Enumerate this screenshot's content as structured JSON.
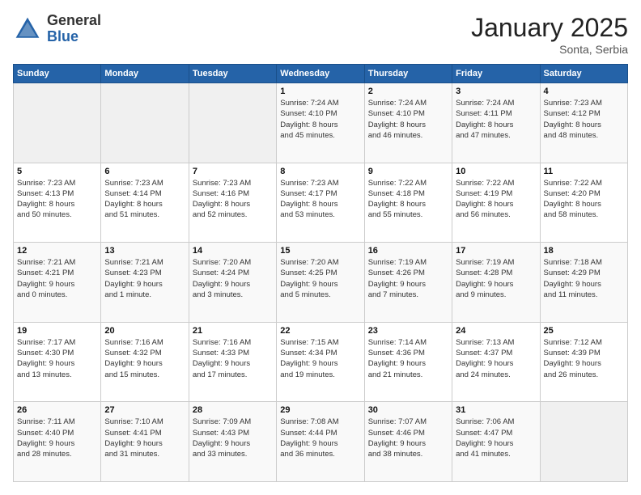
{
  "header": {
    "logo_general": "General",
    "logo_blue": "Blue",
    "month_title": "January 2025",
    "subtitle": "Sonta, Serbia"
  },
  "days_of_week": [
    "Sunday",
    "Monday",
    "Tuesday",
    "Wednesday",
    "Thursday",
    "Friday",
    "Saturday"
  ],
  "weeks": [
    [
      {
        "day": "",
        "info": ""
      },
      {
        "day": "",
        "info": ""
      },
      {
        "day": "",
        "info": ""
      },
      {
        "day": "1",
        "info": "Sunrise: 7:24 AM\nSunset: 4:10 PM\nDaylight: 8 hours\nand 45 minutes."
      },
      {
        "day": "2",
        "info": "Sunrise: 7:24 AM\nSunset: 4:10 PM\nDaylight: 8 hours\nand 46 minutes."
      },
      {
        "day": "3",
        "info": "Sunrise: 7:24 AM\nSunset: 4:11 PM\nDaylight: 8 hours\nand 47 minutes."
      },
      {
        "day": "4",
        "info": "Sunrise: 7:23 AM\nSunset: 4:12 PM\nDaylight: 8 hours\nand 48 minutes."
      }
    ],
    [
      {
        "day": "5",
        "info": "Sunrise: 7:23 AM\nSunset: 4:13 PM\nDaylight: 8 hours\nand 50 minutes."
      },
      {
        "day": "6",
        "info": "Sunrise: 7:23 AM\nSunset: 4:14 PM\nDaylight: 8 hours\nand 51 minutes."
      },
      {
        "day": "7",
        "info": "Sunrise: 7:23 AM\nSunset: 4:16 PM\nDaylight: 8 hours\nand 52 minutes."
      },
      {
        "day": "8",
        "info": "Sunrise: 7:23 AM\nSunset: 4:17 PM\nDaylight: 8 hours\nand 53 minutes."
      },
      {
        "day": "9",
        "info": "Sunrise: 7:22 AM\nSunset: 4:18 PM\nDaylight: 8 hours\nand 55 minutes."
      },
      {
        "day": "10",
        "info": "Sunrise: 7:22 AM\nSunset: 4:19 PM\nDaylight: 8 hours\nand 56 minutes."
      },
      {
        "day": "11",
        "info": "Sunrise: 7:22 AM\nSunset: 4:20 PM\nDaylight: 8 hours\nand 58 minutes."
      }
    ],
    [
      {
        "day": "12",
        "info": "Sunrise: 7:21 AM\nSunset: 4:21 PM\nDaylight: 9 hours\nand 0 minutes."
      },
      {
        "day": "13",
        "info": "Sunrise: 7:21 AM\nSunset: 4:23 PM\nDaylight: 9 hours\nand 1 minute."
      },
      {
        "day": "14",
        "info": "Sunrise: 7:20 AM\nSunset: 4:24 PM\nDaylight: 9 hours\nand 3 minutes."
      },
      {
        "day": "15",
        "info": "Sunrise: 7:20 AM\nSunset: 4:25 PM\nDaylight: 9 hours\nand 5 minutes."
      },
      {
        "day": "16",
        "info": "Sunrise: 7:19 AM\nSunset: 4:26 PM\nDaylight: 9 hours\nand 7 minutes."
      },
      {
        "day": "17",
        "info": "Sunrise: 7:19 AM\nSunset: 4:28 PM\nDaylight: 9 hours\nand 9 minutes."
      },
      {
        "day": "18",
        "info": "Sunrise: 7:18 AM\nSunset: 4:29 PM\nDaylight: 9 hours\nand 11 minutes."
      }
    ],
    [
      {
        "day": "19",
        "info": "Sunrise: 7:17 AM\nSunset: 4:30 PM\nDaylight: 9 hours\nand 13 minutes."
      },
      {
        "day": "20",
        "info": "Sunrise: 7:16 AM\nSunset: 4:32 PM\nDaylight: 9 hours\nand 15 minutes."
      },
      {
        "day": "21",
        "info": "Sunrise: 7:16 AM\nSunset: 4:33 PM\nDaylight: 9 hours\nand 17 minutes."
      },
      {
        "day": "22",
        "info": "Sunrise: 7:15 AM\nSunset: 4:34 PM\nDaylight: 9 hours\nand 19 minutes."
      },
      {
        "day": "23",
        "info": "Sunrise: 7:14 AM\nSunset: 4:36 PM\nDaylight: 9 hours\nand 21 minutes."
      },
      {
        "day": "24",
        "info": "Sunrise: 7:13 AM\nSunset: 4:37 PM\nDaylight: 9 hours\nand 24 minutes."
      },
      {
        "day": "25",
        "info": "Sunrise: 7:12 AM\nSunset: 4:39 PM\nDaylight: 9 hours\nand 26 minutes."
      }
    ],
    [
      {
        "day": "26",
        "info": "Sunrise: 7:11 AM\nSunset: 4:40 PM\nDaylight: 9 hours\nand 28 minutes."
      },
      {
        "day": "27",
        "info": "Sunrise: 7:10 AM\nSunset: 4:41 PM\nDaylight: 9 hours\nand 31 minutes."
      },
      {
        "day": "28",
        "info": "Sunrise: 7:09 AM\nSunset: 4:43 PM\nDaylight: 9 hours\nand 33 minutes."
      },
      {
        "day": "29",
        "info": "Sunrise: 7:08 AM\nSunset: 4:44 PM\nDaylight: 9 hours\nand 36 minutes."
      },
      {
        "day": "30",
        "info": "Sunrise: 7:07 AM\nSunset: 4:46 PM\nDaylight: 9 hours\nand 38 minutes."
      },
      {
        "day": "31",
        "info": "Sunrise: 7:06 AM\nSunset: 4:47 PM\nDaylight: 9 hours\nand 41 minutes."
      },
      {
        "day": "",
        "info": ""
      }
    ]
  ]
}
